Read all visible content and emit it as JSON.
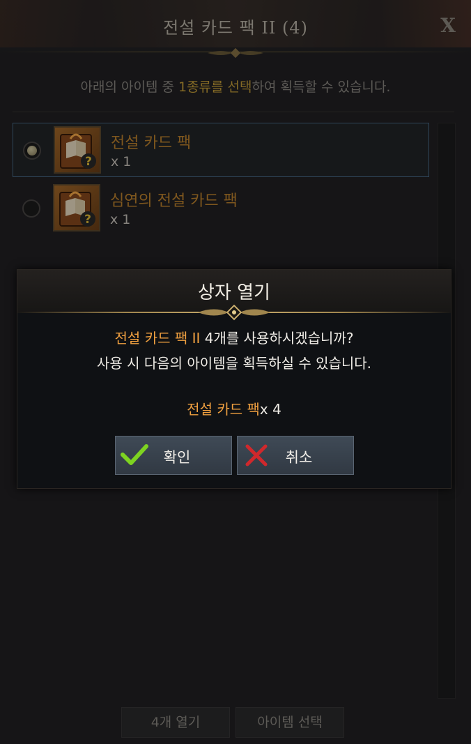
{
  "window": {
    "title": "전설 카드 팩 II (4)",
    "close_label": "X",
    "instruction_before": "아래의 아이템 중 ",
    "instruction_highlight": "1종류를 선택",
    "instruction_after": "하여 획득할 수 있습니다."
  },
  "items": [
    {
      "name": "전설 카드 팩",
      "qty": "x 1",
      "selected": true,
      "icon": "card-pack-icon"
    },
    {
      "name": "심연의 전설 카드 팩",
      "qty": "x 1",
      "selected": false,
      "icon": "card-pack-icon"
    }
  ],
  "bottom_buttons": {
    "open_label": "4개 열기",
    "select_label": "아이템 선택"
  },
  "dialog": {
    "title": "상자 열기",
    "line1_item": "전설 카드 팩 II",
    "line1_text": " 4개를 사용하시겠습니까?",
    "line2": "사용 시 다음의 아이템을 획득하실 수 있습니다.",
    "reward_item": "전설 카드 팩",
    "reward_qty": "x 4",
    "confirm_label": "확인",
    "cancel_label": "취소"
  },
  "colors": {
    "item_name": "#c4862e",
    "highlight": "#c9a13a",
    "dialog_orange": "#f0a040",
    "confirm_check": "#7ed321",
    "cancel_x": "#d0282c"
  }
}
